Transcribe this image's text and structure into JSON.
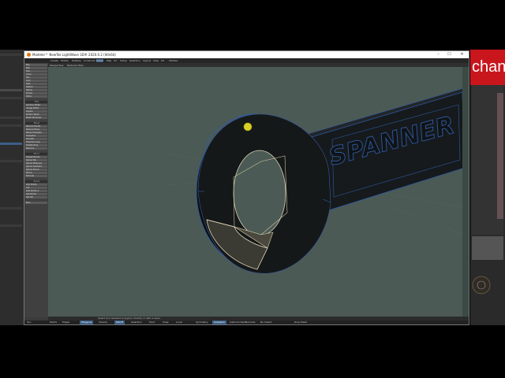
{
  "window": {
    "title": "Modeler™ NewTek LightWave 3D® 2020.0.2 (Win64)",
    "min": "–",
    "max": "☐",
    "close": "✕"
  },
  "menu": [
    "Create",
    "Modify",
    "Multiply",
    "Construct",
    "Detail",
    "Map",
    "UV",
    "Setup",
    "Selection",
    "Layout",
    "View",
    "UX",
    "Utilities"
  ],
  "toolbar": {
    "viewport_label": "Perspective",
    "shading_label": "Textured Wire"
  },
  "tools": {
    "top": [
      "Box",
      "Ball",
      "Disc",
      "Cone",
      "Pen",
      "Grid",
      "Text",
      "Sketch",
      "Spline",
      "Points",
      "Extra"
    ],
    "groupA": [
      "Surface Editor",
      "Image Editor",
      "Layers",
      "Motion Stack",
      "Mesh Windows"
    ],
    "groupB": [
      "Reduce Points",
      "Reduce Polys",
      "Bevel Triangles",
      "Subpatch",
      "Smooth",
      "Dissolve Loop",
      "Delete Ring",
      "Remove"
    ],
    "groupC": [
      "Sweep Bones",
      "Spline Tail",
      "Spline Measure",
      "Spline Subtract",
      "Spline Fence",
      "Mirror",
      "Extrude"
    ],
    "groupD": [
      "Add Points",
      "Cut",
      "Add Points 2",
      "Del Points",
      "Set Val"
    ],
    "headers": [
      "Create",
      "Edit",
      "Bevel",
      "Mirror",
      "Points",
      "Add"
    ],
    "bottom": "Misc"
  },
  "model_text": "SPANNER",
  "status_hint": "Select and deselect polygons directly or with a lasso.",
  "bottombar": {
    "sel": "Sel:",
    "points": "Points",
    "edges": "Edges",
    "polygons": "Polygons",
    "volume": "Volume",
    "falloff": "Falloff",
    "selection": "Selection",
    "pivot": "Pivot",
    "snap": "Snap",
    "local": "Local",
    "symmetry": "Symmetry",
    "sub": "Subpatch",
    "catmull": "Catmull-Clark",
    "normals": "Normals",
    "no_select": "No Select",
    "drop_mesh": "Drop Mesh"
  },
  "bg_text": "chan"
}
